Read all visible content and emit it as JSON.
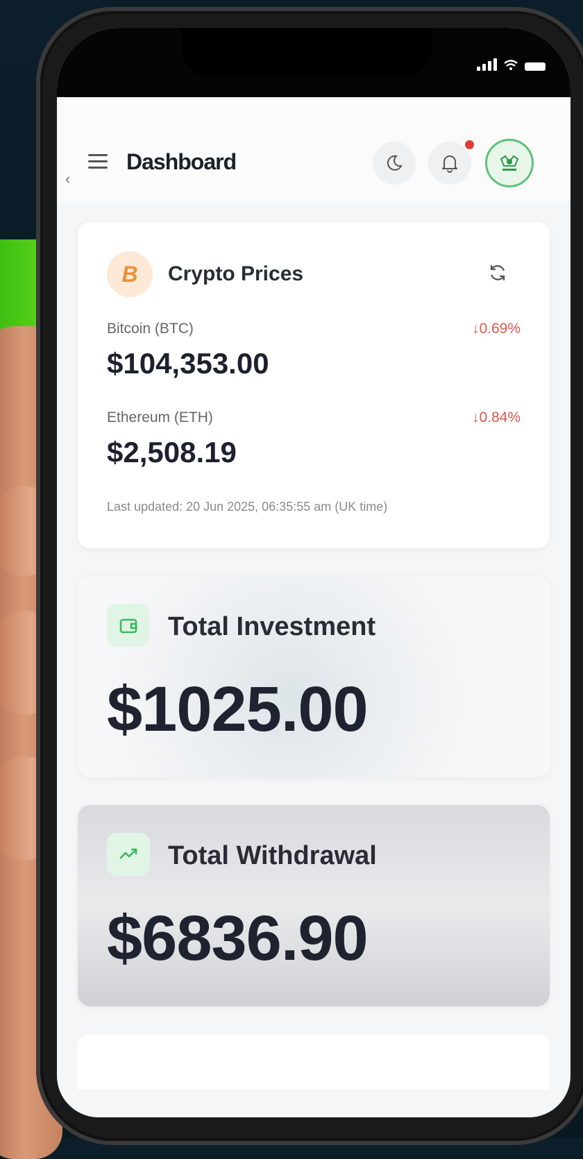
{
  "header": {
    "title": "Dashboard"
  },
  "crypto": {
    "title": "Crypto Prices",
    "badge_symbol": "B",
    "coins": [
      {
        "name": "Bitcoin (BTC)",
        "change": "↓0.69%",
        "price": "$104,353.00"
      },
      {
        "name": "Ethereum (ETH)",
        "change": "↓0.84%",
        "price": "$2,508.19"
      }
    ],
    "last_updated": "Last updated: 20 Jun 2025, 06:35:55 am (UK time)"
  },
  "investment": {
    "label": "Total Investment",
    "value": "$1025.00",
    "icon": "wallet-icon"
  },
  "withdrawal": {
    "label": "Total Withdrawal",
    "value": "$6836.90",
    "icon": "trending-up-icon"
  },
  "colors": {
    "negative": "#e0554f",
    "accent_green": "#3bb85c",
    "bitcoin_orange": "#e8923a"
  }
}
